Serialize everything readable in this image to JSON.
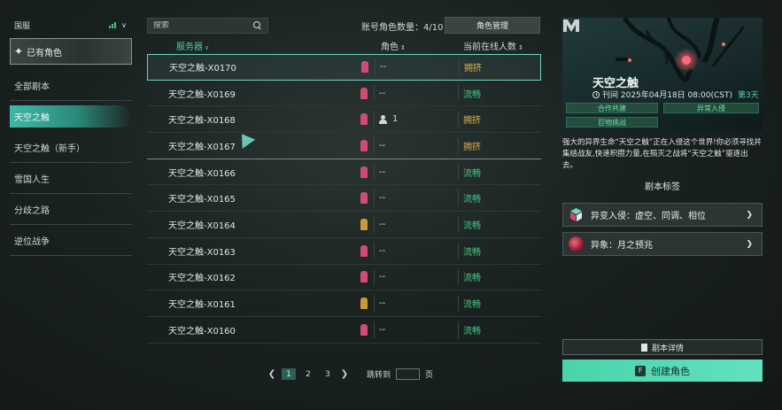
{
  "region": {
    "name": "国服"
  },
  "sidebar": {
    "owned_label": "已有角色",
    "items": [
      {
        "label": "全部剧本",
        "active": false
      },
      {
        "label": "天空之触",
        "active": true
      },
      {
        "label": "天空之触（新手）",
        "active": false
      },
      {
        "label": "雪国人生",
        "active": false
      },
      {
        "label": "分歧之路",
        "active": false
      },
      {
        "label": "逆位战争",
        "active": false
      }
    ]
  },
  "search": {
    "placeholder": "搜索"
  },
  "account": {
    "count_text": "账号角色数量：4/10",
    "manage_label": "角色管理"
  },
  "table": {
    "headers": {
      "server": "服务器",
      "role": "角色",
      "online": "当前在线人数"
    },
    "rows": [
      {
        "name": "天空之触-X0170",
        "figure_color": "#d14b74",
        "chars": "--",
        "status": "拥挤",
        "status_type": "busy",
        "selected": true
      },
      {
        "name": "天空之触-X0169",
        "figure_color": "#d14b74",
        "chars": "--",
        "status": "流畅",
        "status_type": "smooth"
      },
      {
        "name": "天空之触-X0168",
        "figure_color": "#d14b74",
        "chars": "1",
        "has_person": true,
        "status": "拥挤",
        "status_type": "busy"
      },
      {
        "name": "天空之触-X0167",
        "figure_color": "#d14b74",
        "chars": "--",
        "status": "拥挤",
        "status_type": "busy"
      },
      {
        "name": "天空之触-X0166",
        "figure_color": "#d14b74",
        "chars": "--",
        "status": "流畅",
        "status_type": "smooth"
      },
      {
        "name": "天空之触-X0165",
        "figure_color": "#d14b74",
        "chars": "--",
        "status": "流畅",
        "status_type": "smooth"
      },
      {
        "name": "天空之触-X0164",
        "figure_color": "#c99a3b",
        "chars": "--",
        "status": "流畅",
        "status_type": "smooth"
      },
      {
        "name": "天空之触-X0163",
        "figure_color": "#d14b74",
        "chars": "--",
        "status": "流畅",
        "status_type": "smooth"
      },
      {
        "name": "天空之触-X0162",
        "figure_color": "#d14b74",
        "chars": "--",
        "status": "流畅",
        "status_type": "smooth"
      },
      {
        "name": "天空之触-X0161",
        "figure_color": "#c99a3b",
        "chars": "--",
        "status": "流畅",
        "status_type": "smooth"
      },
      {
        "name": "天空之触-X0160",
        "figure_color": "#d14b74",
        "chars": "--",
        "status": "流畅",
        "status_type": "smooth"
      }
    ]
  },
  "pagination": {
    "pages": [
      "1",
      "2",
      "3"
    ],
    "current": "1",
    "jump_label": "跳转到",
    "page_suffix": "页"
  },
  "scenario": {
    "title": "天空之触",
    "time_prefix": "刊间 2025年04月18日 08:00(CST)",
    "day_label": "第3天",
    "tags": [
      "合作共建",
      "异常入侵",
      "巨物挑战"
    ],
    "description": "强大的异界生命“天空之触”正在入侵这个世界!你必须寻找并集结战友,快速积攒力量,在殒灭之战将“天空之触”驱逐出去。",
    "tag_heading": "剧本标签",
    "features": [
      {
        "label": "异变入侵：虚空、同调、相位"
      },
      {
        "label": "异象：月之预兆"
      }
    ],
    "detail_label": "剧本详情",
    "create_key": "F",
    "create_label": "创建角色"
  },
  "colors": {
    "accent": "#4ad3ab",
    "busy": "#e1b251",
    "smooth": "#45c78a"
  }
}
